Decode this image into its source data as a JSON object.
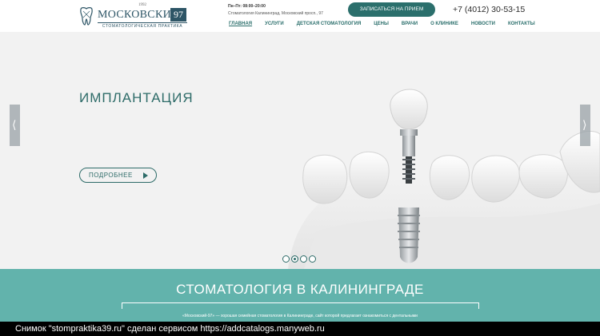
{
  "header": {
    "logo": {
      "year": "1992",
      "name": "МОСКОВСКИЙ",
      "number": "97",
      "subtitle": "СТОМАТОЛОГИЧЕСКАЯ ПРАКТИКА"
    },
    "hours": "Пн–Пт: 08:00–20:00",
    "address": "Стоматология Калининград, Московский просп., 97",
    "cta_label": "ЗАПИСАТЬСЯ НА ПРИЕМ",
    "phone": "+7 (4012) 30-53-15",
    "nav": [
      {
        "label": "ГЛАВНАЯ"
      },
      {
        "label": "УСЛУГИ"
      },
      {
        "label": "ДЕТСКАЯ СТОМАТОЛОГИЯ"
      },
      {
        "label": "ЦЕНЫ"
      },
      {
        "label": "ВРАЧИ"
      },
      {
        "label": "О КЛИНИКЕ"
      },
      {
        "label": "НОВОСТИ"
      },
      {
        "label": "КОНТАКТЫ"
      }
    ],
    "active_nav_index": 0
  },
  "hero": {
    "title": "ИМПЛАНТАЦИЯ",
    "button_label": "ПОДРОБНЕЕ",
    "slides_total": 4,
    "active_slide": 2
  },
  "band": {
    "title": "СТОМАТОЛОГИЯ В КАЛИНИНГРАДЕ",
    "text": "«Московский-97» — хорошая семейная стоматология в Калининграде, сайт которой предлагает ознакомиться с дентальными"
  },
  "caption": "Снимок \"stompraktika39.ru\" сделан сервисом https://addcatalogs.manyweb.ru",
  "colors": {
    "brand_teal": "#2b6f6c",
    "band_teal": "#62b3ac",
    "logo_blue": "#2d5566"
  }
}
